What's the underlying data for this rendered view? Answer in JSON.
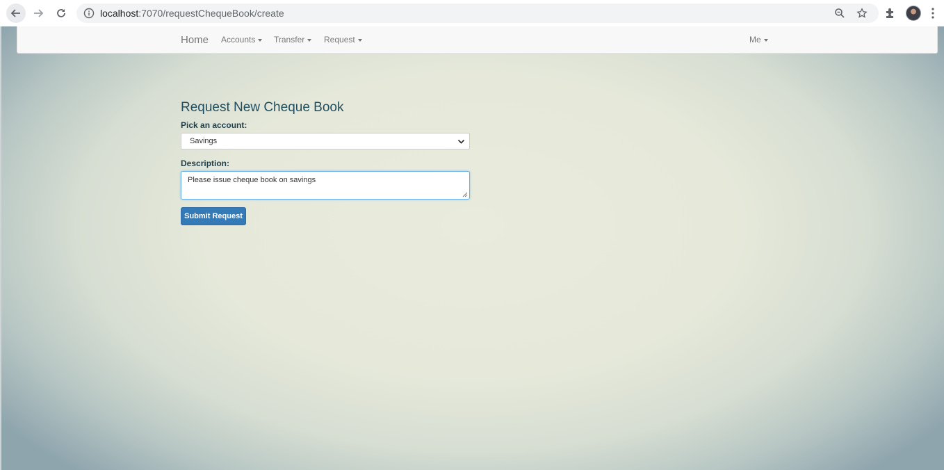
{
  "browser": {
    "url_host": "localhost",
    "url_path": ":7070/requestChequeBook/create"
  },
  "navbar": {
    "brand": "Home",
    "menus": [
      "Accounts",
      "Transfer",
      "Request"
    ],
    "right_menu": "Me"
  },
  "form": {
    "title": "Request New Cheque Book",
    "account_label": "Pick an account:",
    "account_selected": "Savings",
    "description_label": "Description:",
    "description_value": "Please issue cheque book on savings",
    "submit_label": "Submit Request"
  },
  "colors": {
    "primary_button": "#337ab7",
    "title": "#1f4e60"
  },
  "icons": [
    "back-icon",
    "forward-icon",
    "reload-icon",
    "info-icon",
    "zoom-icon",
    "star-icon",
    "extensions-icon",
    "profile-avatar",
    "menu-kebab-icon",
    "chevron-down-icon"
  ]
}
